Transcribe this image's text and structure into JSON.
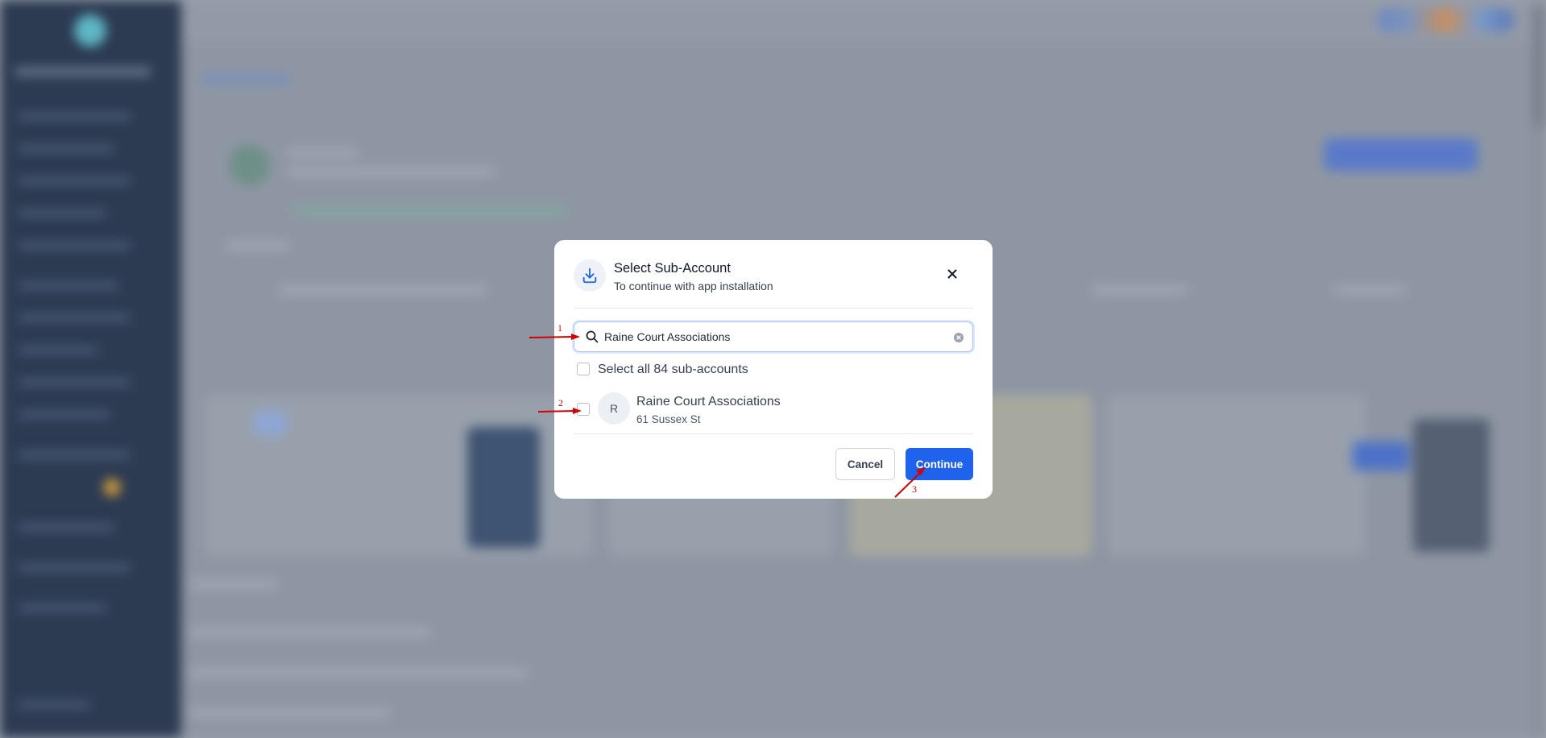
{
  "modal": {
    "title": "Select Sub-Account",
    "subtitle": "To continue with app installation",
    "header_icon": "download-icon",
    "close_icon": "close-icon",
    "search": {
      "value": "Raine Court Associations",
      "icon": "search-icon",
      "clear_icon": "clear-icon"
    },
    "select_all_label": "Select all 84 sub-accounts",
    "accounts": [
      {
        "initial": "R",
        "name": "Raine Court Associations",
        "address": "61 Sussex St",
        "checked": false
      }
    ],
    "cancel_label": "Cancel",
    "continue_label": "Continue"
  },
  "annotations": [
    "1",
    "2",
    "3"
  ],
  "colors": {
    "primary": "#1f63ec",
    "annotation": "#d60000",
    "sidebar": "#2c3a52"
  }
}
